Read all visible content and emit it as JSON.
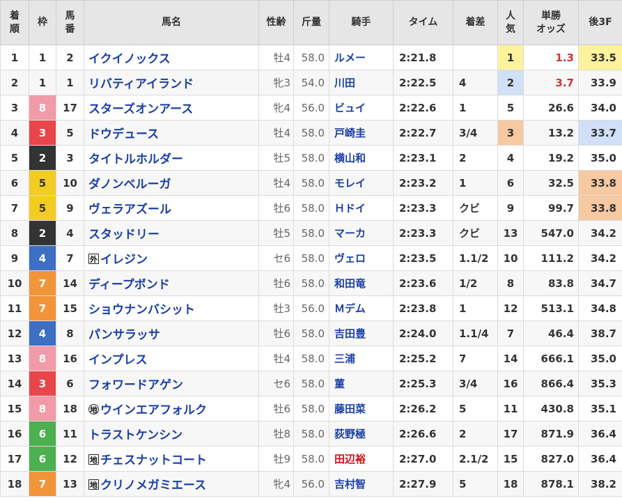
{
  "headers": {
    "rank": "着\n順",
    "frame": "枠",
    "number": "馬\n番",
    "horse": "馬名",
    "sexage": "性齢",
    "weight": "斤量",
    "jockey": "騎手",
    "time": "タイム",
    "margin": "着差",
    "popularity": "人\n気",
    "odds": "単勝\nオッズ",
    "last3f": "後3F"
  },
  "colors": {
    "frame_1": "#ffffff",
    "frame_2": "#333333",
    "frame_3": "#e8464a",
    "frame_4": "#3d6fc4",
    "frame_5": "#f2cc22",
    "frame_6": "#4caf50",
    "frame_7": "#f2943a",
    "frame_8": "#f19aa8",
    "highlight_yellow": "#fff29c",
    "highlight_blue": "#cfe0f7",
    "highlight_orange": "#f6c9a2",
    "horse_link": "#1a3ea8",
    "red_text": "#cc1111"
  },
  "rows": [
    {
      "rank": "1",
      "frame": "1",
      "number": "2",
      "prefix": "",
      "prefix_shape": "",
      "horse": "イクイノックス",
      "sexage": "牡4",
      "weight": "58.0",
      "jockey": "ルメー",
      "jockey_red": false,
      "time": "2:21.8",
      "margin": "",
      "popularity": "1",
      "pop_hl": "yellow",
      "odds": "1.3",
      "odds_red": true,
      "last3f": "33.5",
      "l3f_hl": "yellow"
    },
    {
      "rank": "2",
      "frame": "1",
      "number": "1",
      "prefix": "",
      "prefix_shape": "",
      "horse": "リバティアイランド",
      "sexage": "牝3",
      "weight": "54.0",
      "jockey": "川田",
      "jockey_red": false,
      "time": "2:22.5",
      "margin": "4",
      "popularity": "2",
      "pop_hl": "blue",
      "odds": "3.7",
      "odds_red": true,
      "last3f": "33.9",
      "l3f_hl": ""
    },
    {
      "rank": "3",
      "frame": "8",
      "number": "17",
      "prefix": "",
      "prefix_shape": "",
      "horse": "スターズオンアース",
      "sexage": "牝4",
      "weight": "56.0",
      "jockey": "ビュイ",
      "jockey_red": false,
      "time": "2:22.6",
      "margin": "1",
      "popularity": "5",
      "pop_hl": "",
      "odds": "26.6",
      "odds_red": false,
      "last3f": "34.0",
      "l3f_hl": ""
    },
    {
      "rank": "4",
      "frame": "3",
      "number": "5",
      "prefix": "",
      "prefix_shape": "",
      "horse": "ドウデュース",
      "sexage": "牡4",
      "weight": "58.0",
      "jockey": "戸崎圭",
      "jockey_red": false,
      "time": "2:22.7",
      "margin": "3/4",
      "popularity": "3",
      "pop_hl": "orange",
      "odds": "13.2",
      "odds_red": false,
      "last3f": "33.7",
      "l3f_hl": "blue"
    },
    {
      "rank": "5",
      "frame": "2",
      "number": "3",
      "prefix": "",
      "prefix_shape": "",
      "horse": "タイトルホルダー",
      "sexage": "牡5",
      "weight": "58.0",
      "jockey": "横山和",
      "jockey_red": false,
      "time": "2:23.1",
      "margin": "2",
      "popularity": "4",
      "pop_hl": "",
      "odds": "19.2",
      "odds_red": false,
      "last3f": "35.0",
      "l3f_hl": ""
    },
    {
      "rank": "6",
      "frame": "5",
      "number": "10",
      "prefix": "",
      "prefix_shape": "",
      "horse": "ダノンベルーガ",
      "sexage": "牡4",
      "weight": "58.0",
      "jockey": "モレイ",
      "jockey_red": false,
      "time": "2:23.2",
      "margin": "1",
      "popularity": "6",
      "pop_hl": "",
      "odds": "32.5",
      "odds_red": false,
      "last3f": "33.8",
      "l3f_hl": "orange"
    },
    {
      "rank": "7",
      "frame": "5",
      "number": "9",
      "prefix": "",
      "prefix_shape": "",
      "horse": "ヴェラアズール",
      "sexage": "牡6",
      "weight": "58.0",
      "jockey": "Ｈドイ",
      "jockey_red": false,
      "time": "2:23.3",
      "margin": "クビ",
      "popularity": "9",
      "pop_hl": "",
      "odds": "99.7",
      "odds_red": false,
      "last3f": "33.8",
      "l3f_hl": "orange"
    },
    {
      "rank": "8",
      "frame": "2",
      "number": "4",
      "prefix": "",
      "prefix_shape": "",
      "horse": "スタッドリー",
      "sexage": "牡5",
      "weight": "58.0",
      "jockey": "マーカ",
      "jockey_red": false,
      "time": "2:23.3",
      "margin": "クビ",
      "popularity": "13",
      "pop_hl": "",
      "odds": "547.0",
      "odds_red": false,
      "last3f": "34.2",
      "l3f_hl": ""
    },
    {
      "rank": "9",
      "frame": "4",
      "number": "7",
      "prefix": "外",
      "prefix_shape": "box",
      "horse": "イレジン",
      "sexage": "セ6",
      "weight": "58.0",
      "jockey": "ヴェロ",
      "jockey_red": false,
      "time": "2:23.5",
      "margin": "1.1/2",
      "popularity": "10",
      "pop_hl": "",
      "odds": "111.2",
      "odds_red": false,
      "last3f": "34.2",
      "l3f_hl": ""
    },
    {
      "rank": "10",
      "frame": "7",
      "number": "14",
      "prefix": "",
      "prefix_shape": "",
      "horse": "ディープボンド",
      "sexage": "牡6",
      "weight": "58.0",
      "jockey": "和田竜",
      "jockey_red": false,
      "time": "2:23.6",
      "margin": "1/2",
      "popularity": "8",
      "pop_hl": "",
      "odds": "83.8",
      "odds_red": false,
      "last3f": "34.7",
      "l3f_hl": ""
    },
    {
      "rank": "11",
      "frame": "7",
      "number": "15",
      "prefix": "",
      "prefix_shape": "",
      "horse": "ショウナンバシット",
      "sexage": "牡3",
      "weight": "56.0",
      "jockey": "Ｍデム",
      "jockey_red": false,
      "time": "2:23.8",
      "margin": "1",
      "popularity": "12",
      "pop_hl": "",
      "odds": "513.1",
      "odds_red": false,
      "last3f": "34.8",
      "l3f_hl": ""
    },
    {
      "rank": "12",
      "frame": "4",
      "number": "8",
      "prefix": "",
      "prefix_shape": "",
      "horse": "パンサラッサ",
      "sexage": "牡6",
      "weight": "58.0",
      "jockey": "吉田豊",
      "jockey_red": false,
      "time": "2:24.0",
      "margin": "1.1/4",
      "popularity": "7",
      "pop_hl": "",
      "odds": "46.4",
      "odds_red": false,
      "last3f": "38.7",
      "l3f_hl": ""
    },
    {
      "rank": "13",
      "frame": "8",
      "number": "16",
      "prefix": "",
      "prefix_shape": "",
      "horse": "インプレス",
      "sexage": "牡4",
      "weight": "58.0",
      "jockey": "三浦",
      "jockey_red": false,
      "time": "2:25.2",
      "margin": "7",
      "popularity": "14",
      "pop_hl": "",
      "odds": "666.1",
      "odds_red": false,
      "last3f": "35.0",
      "l3f_hl": ""
    },
    {
      "rank": "14",
      "frame": "3",
      "number": "6",
      "prefix": "",
      "prefix_shape": "",
      "horse": "フォワードアゲン",
      "sexage": "セ6",
      "weight": "58.0",
      "jockey": "菫",
      "jockey_red": false,
      "time": "2:25.3",
      "margin": "3/4",
      "popularity": "16",
      "pop_hl": "",
      "odds": "866.4",
      "odds_red": false,
      "last3f": "35.3",
      "l3f_hl": ""
    },
    {
      "rank": "15",
      "frame": "8",
      "number": "18",
      "prefix": "地",
      "prefix_shape": "circle",
      "horse": "ウインエアフォルク",
      "sexage": "牡6",
      "weight": "58.0",
      "jockey": "藤田菜",
      "jockey_red": false,
      "time": "2:26.2",
      "margin": "5",
      "popularity": "11",
      "pop_hl": "",
      "odds": "430.8",
      "odds_red": false,
      "last3f": "35.1",
      "l3f_hl": ""
    },
    {
      "rank": "16",
      "frame": "6",
      "number": "11",
      "prefix": "",
      "prefix_shape": "",
      "horse": "トラストケンシン",
      "sexage": "牡8",
      "weight": "58.0",
      "jockey": "荻野極",
      "jockey_red": false,
      "time": "2:26.6",
      "margin": "2",
      "popularity": "17",
      "pop_hl": "",
      "odds": "871.9",
      "odds_red": false,
      "last3f": "36.4",
      "l3f_hl": ""
    },
    {
      "rank": "17",
      "frame": "6",
      "number": "12",
      "prefix": "地",
      "prefix_shape": "box",
      "horse": "チェスナットコート",
      "sexage": "牡9",
      "weight": "58.0",
      "jockey": "田辺裕",
      "jockey_red": true,
      "time": "2:27.0",
      "margin": "2.1/2",
      "popularity": "15",
      "pop_hl": "",
      "odds": "827.0",
      "odds_red": false,
      "last3f": "36.4",
      "l3f_hl": ""
    },
    {
      "rank": "18",
      "frame": "7",
      "number": "13",
      "prefix": "地",
      "prefix_shape": "box",
      "horse": "クリノメガミエース",
      "sexage": "牝4",
      "weight": "56.0",
      "jockey": "吉村智",
      "jockey_red": false,
      "time": "2:27.9",
      "margin": "5",
      "popularity": "18",
      "pop_hl": "",
      "odds": "878.1",
      "odds_red": false,
      "last3f": "38.2",
      "l3f_hl": ""
    }
  ]
}
